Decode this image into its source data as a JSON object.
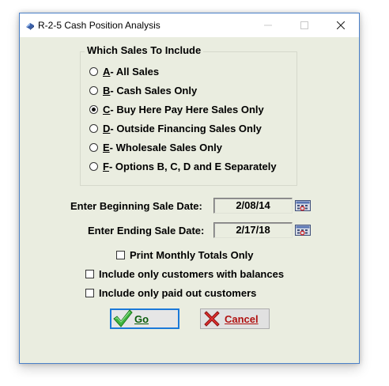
{
  "window": {
    "title": "R-2-5  Cash Position Analysis"
  },
  "sales_group": {
    "title": "Which Sales To Include",
    "options": [
      {
        "key": "A",
        "text": " - All Sales",
        "checked": false
      },
      {
        "key": "B",
        "text": " - Cash Sales Only",
        "checked": false
      },
      {
        "key": "C",
        "text": " - Buy Here Pay Here Sales Only",
        "checked": true
      },
      {
        "key": "D",
        "text": " - Outside Financing Sales Only",
        "checked": false
      },
      {
        "key": "E",
        "text": " - Wholesale Sales Only",
        "checked": false
      },
      {
        "key": "F",
        "text": " - Options B, C, D and E Separately",
        "checked": false
      }
    ]
  },
  "dates": {
    "begin_label": "Enter Beginning Sale Date:",
    "begin_value": "2/08/14",
    "end_label": "Enter Ending Sale Date:",
    "end_value": "2/17/18"
  },
  "checkboxes": {
    "monthly": {
      "label": "Print Monthly Totals Only",
      "checked": false
    },
    "balances": {
      "label": "Include only customers with balances",
      "checked": false
    },
    "paid_out": {
      "label": "Include only paid out customers",
      "checked": false
    }
  },
  "buttons": {
    "go": "Go",
    "cancel": "Cancel"
  },
  "icons": {
    "app": "app-icon",
    "minimize": "minimize-icon",
    "maximize": "maximize-icon",
    "close": "close-icon",
    "calendar": "calendar-icon",
    "go": "checkmark-icon",
    "cancel": "red-x-icon"
  }
}
